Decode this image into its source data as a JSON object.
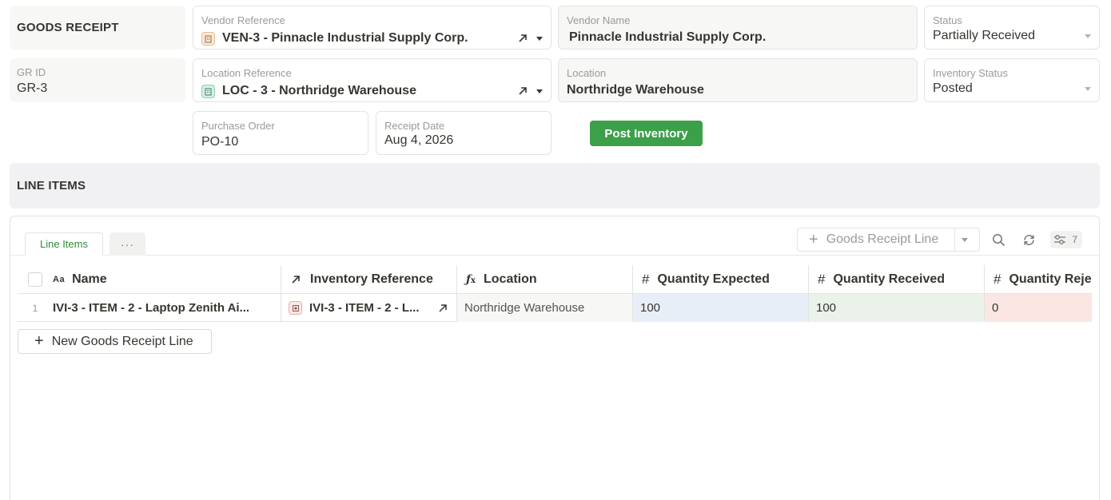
{
  "header": {
    "section_title": "GOODS RECEIPT",
    "gr_id": {
      "label": "GR ID",
      "value": "GR-3"
    },
    "vendor_reference": {
      "label": "Vendor Reference",
      "value": "VEN-3 - Pinnacle Industrial Supply Corp.",
      "icon": "building-icon"
    },
    "location_reference": {
      "label": "Location Reference",
      "value": "LOC - 3 - Northridge Warehouse",
      "icon": "warehouse-icon"
    },
    "purchase_order": {
      "label": "Purchase Order",
      "value": "PO-10"
    },
    "receipt_date": {
      "label": "Receipt Date",
      "value": "Aug 4, 2026"
    },
    "vendor_name": {
      "label": "Vendor Name",
      "value": "Pinnacle Industrial Supply Corp."
    },
    "location": {
      "label": "Location",
      "value": "Northridge Warehouse"
    },
    "status": {
      "label": "Status",
      "value": "Partially Received"
    },
    "inventory_status": {
      "label": "Inventory Status",
      "value": "Posted"
    },
    "post_button_label": "Post Inventory"
  },
  "line_items_section": {
    "title": "LINE ITEMS",
    "tabs": [
      {
        "label": "Line Items",
        "active": true
      }
    ],
    "more_tabs_label": "···",
    "add_button_label": "Goods Receipt Line",
    "fields_count": "7",
    "columns": [
      {
        "icon": "Aa",
        "label": "Name",
        "type": "text"
      },
      {
        "icon": "↗",
        "label": "Inventory Reference",
        "type": "relation"
      },
      {
        "icon": "fx",
        "label": "Location",
        "type": "formula"
      },
      {
        "icon": "#",
        "label": "Quantity Expected",
        "type": "number"
      },
      {
        "icon": "#",
        "label": "Quantity Received",
        "type": "number"
      },
      {
        "icon": "#",
        "label": "Quantity Reje",
        "type": "number"
      }
    ],
    "rows": [
      {
        "index": "1",
        "name": "IVI-3 - ITEM - 2 - Laptop Zenith Ai...",
        "inventory_reference": "IVI-3 - ITEM - 2 - L...",
        "location": "Northridge Warehouse",
        "quantity_expected": "100",
        "quantity_received": "100",
        "quantity_rejected": "0"
      }
    ],
    "new_line_label": "New Goods Receipt Line"
  },
  "colors": {
    "accent_green": "#3c9f4a",
    "expected_bg": "#e8eef8",
    "received_bg": "#eaf2e9",
    "rejected_bg": "#fbe6e4"
  }
}
